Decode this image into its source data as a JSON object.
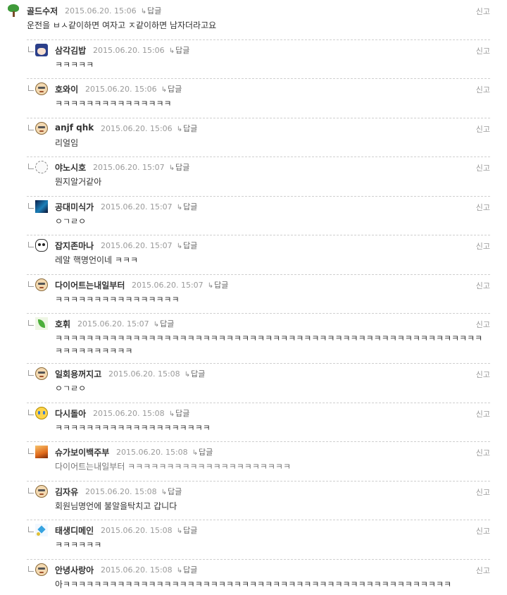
{
  "report_label": "신고",
  "reply_label": "답글",
  "comments": [
    {
      "author": "골드수저",
      "date": "2015.06.20. 15:06",
      "text": "운전을 ㅂㅅ같이하면 여자고 ㅈ같이하면 남자더라고요",
      "avatar": "tree-icon"
    },
    {
      "author": "삼각김밥",
      "date": "2015.06.20. 15:06",
      "text": "ㅋㅋㅋㅋㅋ",
      "avatar": "anime-character-icon"
    },
    {
      "author": "호와이",
      "date": "2015.06.20. 15:06",
      "text": "ㅋㅋㅋㅋㅋㅋㅋㅋㅋㅋㅋㅋㅋㅋㅋ",
      "avatar": "default-face-icon"
    },
    {
      "author": "anjf qhk",
      "date": "2015.06.20. 15:06",
      "text": "리얼임",
      "avatar": "default-face-icon"
    },
    {
      "author": "야노시호",
      "date": "2015.06.20. 15:07",
      "text": "뭔지알거같아",
      "avatar": "cloud-icon"
    },
    {
      "author": "공대미식가",
      "date": "2015.06.20. 15:07",
      "text": "ㅇㄱㄹㅇ",
      "avatar": "space-image-icon"
    },
    {
      "author": "잡지존마나",
      "date": "2015.06.20. 15:07",
      "text": "레알 핵명언이네 ㅋㅋㅋ",
      "avatar": "panda-icon"
    },
    {
      "author": "다이어트는내일부터",
      "date": "2015.06.20. 15:07",
      "text": "ㅋㅋㅋㅋㅋㅋㅋㅋㅋㅋㅋㅋㅋㅋㅋㅋ",
      "avatar": "default-face-icon"
    },
    {
      "author": "호휘",
      "date": "2015.06.20. 15:07",
      "text": "ㅋㅋㅋㅋㅋㅋㅋㅋㅋㅋㅋㅋㅋㅋㅋㅋㅋㅋㅋㅋㅋㅋㅋㅋㅋㅋㅋㅋㅋㅋㅋㅋㅋㅋㅋㅋㅋㅋㅋㅋㅋㅋㅋㅋㅋㅋㅋㅋㅋㅋㅋㅋㅋㅋㅋㅋㅋㅋㅋㅋㅋㅋㅋㅋㅋ",
      "avatar": "leaf-icon"
    },
    {
      "author": "일회용꺼지고",
      "date": "2015.06.20. 15:08",
      "text": "ㅇㄱㄹㅇ",
      "avatar": "default-face-icon"
    },
    {
      "author": "다시돌아",
      "date": "2015.06.20. 15:08",
      "text": "ㅋㅋㅋㅋㅋㅋㅋㅋㅋㅋㅋㅋㅋㅋㅋㅋㅋㅋㅋㅋ",
      "avatar": "crying-face-icon"
    },
    {
      "author": "슈가보이백주부",
      "date": "2015.06.20. 15:08",
      "text": "다이어트는내일부터 ㅋㅋㅋㅋㅋㅋㅋㅋㅋㅋㅋㅋㅋㅋㅋㅋㅋㅋㅋㅋㅋ",
      "avatar": "sunset-image-icon"
    },
    {
      "author": "김자유",
      "date": "2015.06.20. 15:08",
      "text": "회원님명언에 불알을탁치고 갑니다",
      "avatar": "default-face-icon"
    },
    {
      "author": "태생디메인",
      "date": "2015.06.20. 15:08",
      "text": "ㅋㅋㅋㅋㅋㅋ",
      "avatar": "sparkle-icon"
    },
    {
      "author": "안녕사랑아",
      "date": "2015.06.20. 15:08",
      "text": "아ㅋㅋㅋㅋㅋㅋㅋㅋㅋㅋㅋㅋㅋㅋㅋㅋㅋㅋㅋㅋㅋㅋㅋㅋㅋㅋㅋㅋㅋㅋㅋㅋㅋㅋㅋㅋㅋㅋㅋㅋㅋㅋㅋㅋㅋㅋㅋㅋㅋㅋ",
      "avatar": "default-face-icon"
    }
  ]
}
